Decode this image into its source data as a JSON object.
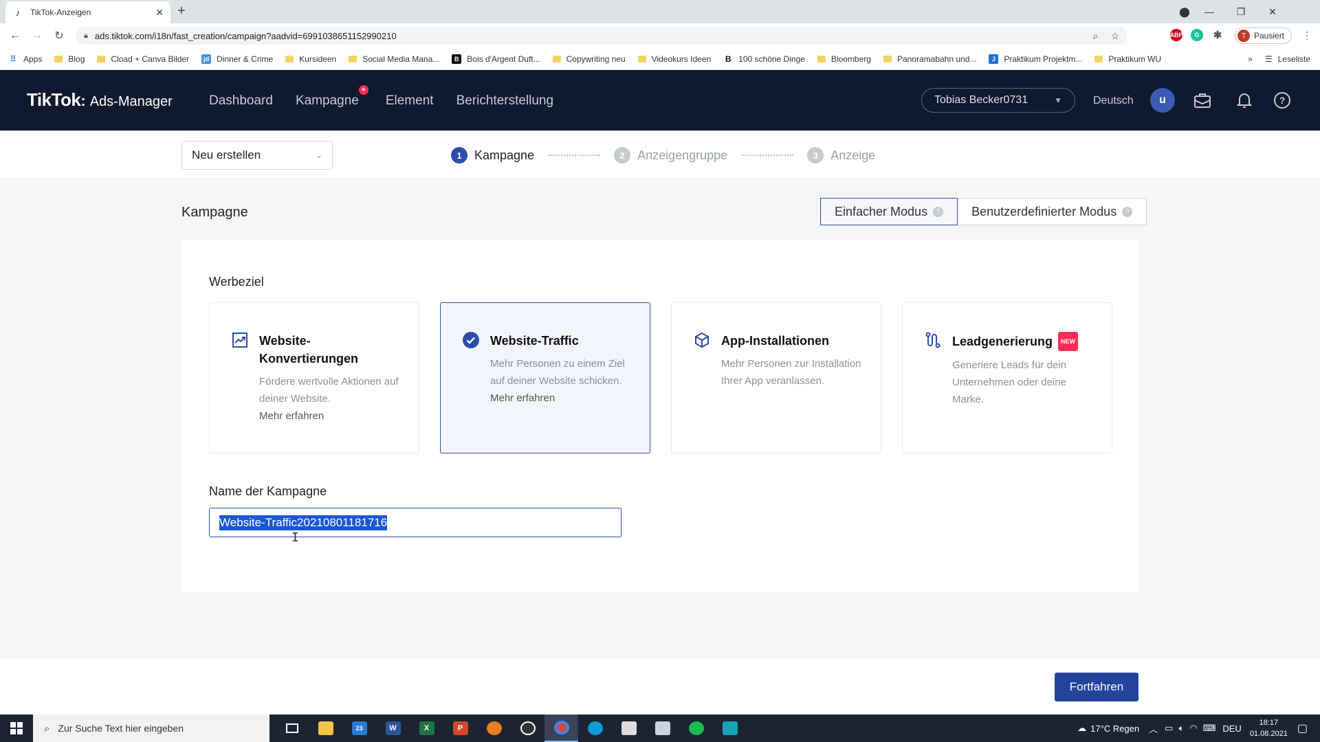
{
  "browser": {
    "tab_title": "TikTok-Anzeigen",
    "url": "ads.tiktok.com/i18n/fast_creation/campaign?aadvid=6991038651152990210",
    "profile_status": "Pausiert",
    "profile_initial": "T",
    "bookmarks": [
      {
        "label": "Apps",
        "icon": "apps-grid-icon"
      },
      {
        "label": "Blog",
        "icon": "folder-icon"
      },
      {
        "label": "Cload + Canva Bilder",
        "icon": "folder-icon"
      },
      {
        "label": "Dinner & Crime",
        "icon": "jd-icon"
      },
      {
        "label": "Kursideen",
        "icon": "folder-icon"
      },
      {
        "label": "Social Media Mana...",
        "icon": "folder-icon"
      },
      {
        "label": "Bois d'Argent Duft...",
        "icon": "site-icon"
      },
      {
        "label": "Copywriting neu",
        "icon": "folder-icon"
      },
      {
        "label": "Videokurs Ideen",
        "icon": "folder-icon"
      },
      {
        "label": "100 schöne Dinge",
        "icon": "b-icon"
      },
      {
        "label": "Bloomberg",
        "icon": "folder-icon"
      },
      {
        "label": "Panoramabahn und...",
        "icon": "folder-icon"
      },
      {
        "label": "Praktikum Projektm...",
        "icon": "j-icon"
      },
      {
        "label": "Praktikum WU",
        "icon": "folder-icon"
      }
    ],
    "reading_list": "Leseliste"
  },
  "header": {
    "brand_main": "TikTok",
    "brand_sub": "Ads-Manager",
    "nav": [
      "Dashboard",
      "Kampagne",
      "Element",
      "Berichterstellung"
    ],
    "account": "Tobias Becker0731",
    "language": "Deutsch",
    "avatar_initial": "u"
  },
  "steps_bar": {
    "create_select": "Neu erstellen",
    "steps": [
      {
        "num": "1",
        "label": "Kampagne"
      },
      {
        "num": "2",
        "label": "Anzeigengruppe"
      },
      {
        "num": "3",
        "label": "Anzeige"
      }
    ]
  },
  "main": {
    "section_title": "Kampagne",
    "modes": [
      "Einfacher Modus",
      "Benutzerdefinierter Modus"
    ],
    "objective_label": "Werbeziel",
    "cards": [
      {
        "title": "Website-Konvertierungen",
        "desc": "Fördere wertvolle Aktionen auf deiner Website.",
        "link": "Mehr erfahren",
        "icon": "conversion-chart-icon"
      },
      {
        "title": "Website-Traffic",
        "desc": "Mehr Personen zu einem Ziel auf deiner Website schicken.",
        "link": "Mehr erfahren",
        "icon": "check-circle-icon"
      },
      {
        "title": "App-Installationen",
        "desc": "Mehr Personen zur Installation Ihrer App veranlassen.",
        "link": "",
        "icon": "cube-icon"
      },
      {
        "title": "Leadgenerierung",
        "desc": "Generiere Leads für dein Unternehmen oder deine Marke.",
        "link": "",
        "badge": "NEW",
        "icon": "lead-flow-icon"
      }
    ],
    "name_label": "Name der Kampagne",
    "name_value": "Website-Traffic20210801181716",
    "continue_button": "Fortfahren"
  },
  "taskbar": {
    "search_placeholder": "Zur Suche Text hier eingeben",
    "weather": "17°C Regen",
    "language": "DEU",
    "time": "18:17",
    "date": "01.08.2021",
    "mail_count": "23"
  },
  "colors": {
    "header_bg": "#0f1a2e",
    "accent": "#2c4da8",
    "tiktok_red": "#fe2c55"
  }
}
